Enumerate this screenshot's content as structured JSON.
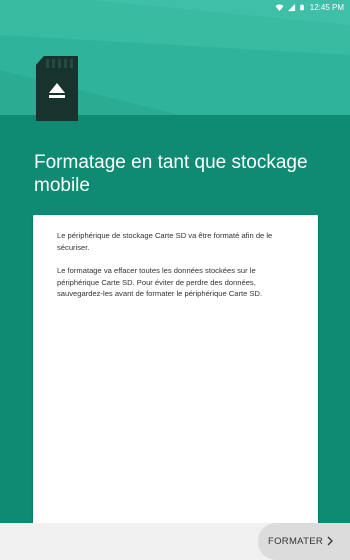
{
  "status_bar": {
    "time": "12:45 PM",
    "icons": [
      "wifi-icon",
      "signal-icon",
      "battery-icon"
    ]
  },
  "colors": {
    "hero": "#2fb39a",
    "main": "#0f8a73",
    "card": "#ffffff",
    "bottom_bar": "#f0f0f0"
  },
  "hero": {
    "icon": "sd-card-eject-icon"
  },
  "title": "Formatage en tant que stockage mobile",
  "card": {
    "paragraph1": "Le périphérique de stockage Carte SD va être formaté afin de le sécuriser.",
    "paragraph2": "Le formatage va effacer toutes les données stockées sur le périphérique Carte SD. Pour éviter de perdre des données, sauvegardez-les avant de formater le périphérique Carte SD."
  },
  "bottom_bar": {
    "next_label": "FORMATER",
    "next_icon": "chevron-right-icon"
  }
}
